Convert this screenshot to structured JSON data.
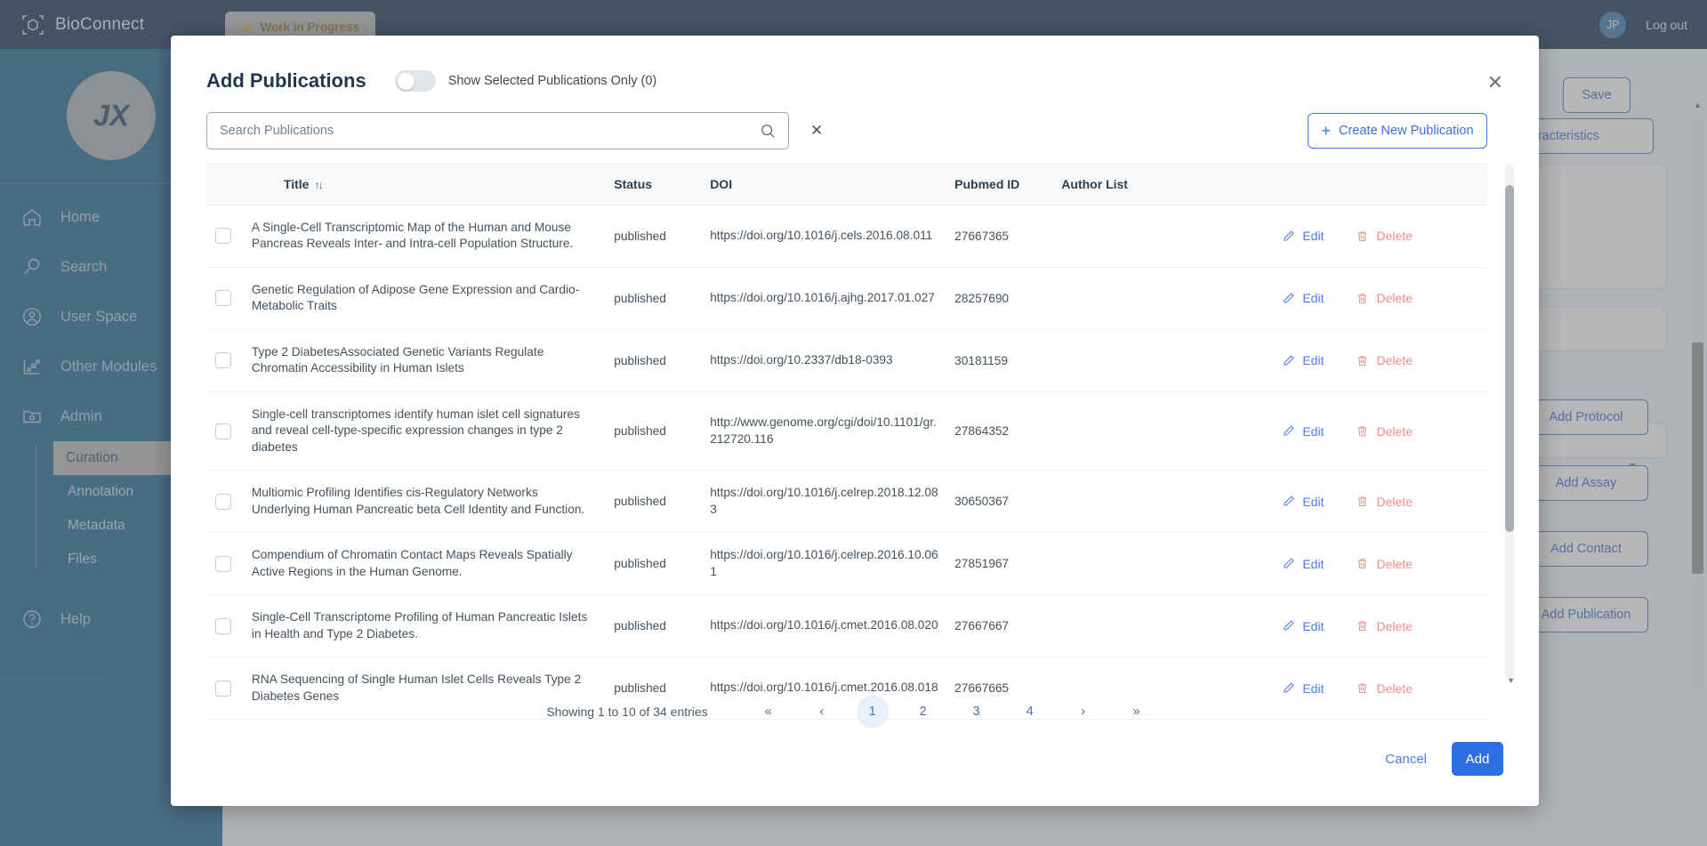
{
  "app": {
    "brand": "BioConnect",
    "brand_icon": "cube-scan-icon",
    "wip_badge": "Work in Progress",
    "wip_icon": "warning-triangle-icon",
    "avatar_initials": "JP",
    "logout": "Log out",
    "org_logo_text": "JX",
    "topbar_color": "#0a2342",
    "sidebar_color": "#0f5c87"
  },
  "sidebar": {
    "items": [
      {
        "label": "Home",
        "icon": "home-icon"
      },
      {
        "label": "Search",
        "icon": "magnifier-icon"
      },
      {
        "label": "User Space",
        "icon": "user-circle-icon"
      },
      {
        "label": "Other Modules",
        "icon": "modules-grid-icon"
      },
      {
        "label": "Admin",
        "icon": "folder-gear-icon"
      }
    ],
    "sub_items": [
      {
        "label": "Curation",
        "active": true
      },
      {
        "label": "Annotation",
        "active": false
      },
      {
        "label": "Metadata",
        "active": false
      },
      {
        "label": "Files",
        "active": false
      }
    ],
    "help": {
      "label": "Help",
      "icon": "help-circle-icon"
    }
  },
  "background_panel": {
    "save_label": "Save",
    "characteristics_label": "d Characteristics",
    "buttons": [
      "Add Protocol",
      "Add Assay",
      "Add Contact",
      "Add Publication"
    ],
    "filter_icon": "funnel-icon"
  },
  "modal": {
    "title": "Add Publications",
    "toggle_label": "Show Selected Publications Only (0)",
    "toggle_on": false,
    "close_icon": "close-icon",
    "search": {
      "placeholder": "Search Publications",
      "value": "",
      "search_icon": "search-icon",
      "clear_icon": "clear-x-icon"
    },
    "create_button": {
      "label": "Create New Publication",
      "icon": "plus-icon"
    },
    "columns": [
      "Title",
      "Status",
      "DOI",
      "Pubmed ID",
      "Author List"
    ],
    "sort_icon": "sort-arrows-icon",
    "row_actions": {
      "edit": {
        "label": "Edit",
        "icon": "pencil-icon",
        "color": "#4c7ce8"
      },
      "delete": {
        "label": "Delete",
        "icon": "trash-icon",
        "color": "#f08b84"
      }
    },
    "rows": [
      {
        "checked": false,
        "title": "A Single-Cell Transcriptomic Map of the Human and Mouse Pancreas Reveals Inter- and Intra-cell Population Structure.",
        "status": "published",
        "doi": "https://doi.org/10.1016/j.cels.2016.08.011",
        "pubmed_id": "27667365",
        "author_list": ""
      },
      {
        "checked": false,
        "title": "Genetic Regulation of Adipose Gene Expression and Cardio-Metabolic Traits",
        "status": "published",
        "doi": "https://doi.org/10.1016/j.ajhg.2017.01.027",
        "pubmed_id": "28257690",
        "author_list": ""
      },
      {
        "checked": false,
        "title": "Type 2 DiabetesAssociated Genetic Variants Regulate Chromatin Accessibility in Human Islets",
        "status": "published",
        "doi": "https://doi.org/10.2337/db18-0393",
        "pubmed_id": "30181159",
        "author_list": ""
      },
      {
        "checked": false,
        "title": "Single-cell transcriptomes identify human islet cell signatures and reveal cell-type-specific expression changes in type 2 diabetes",
        "status": "published",
        "doi": "http://www.genome.org/cgi/doi/10.1101/gr.212720.116",
        "pubmed_id": "27864352",
        "author_list": ""
      },
      {
        "checked": false,
        "title": "Multiomic Profiling Identifies cis-Regulatory Networks Underlying Human Pancreatic beta Cell Identity and Function.",
        "status": "published",
        "doi": "https://doi.org/10.1016/j.celrep.2018.12.083",
        "pubmed_id": "30650367",
        "author_list": ""
      },
      {
        "checked": false,
        "title": "Compendium of Chromatin Contact Maps Reveals Spatially Active Regions in the Human Genome.",
        "status": "published",
        "doi": "https://doi.org/10.1016/j.celrep.2016.10.061",
        "pubmed_id": "27851967",
        "author_list": ""
      },
      {
        "checked": false,
        "title": "Single-Cell Transcriptome Profiling of Human Pancreatic Islets in Health and Type 2 Diabetes.",
        "status": "published",
        "doi": "https://doi.org/10.1016/j.cmet.2016.08.020",
        "pubmed_id": "27667667",
        "author_list": ""
      },
      {
        "checked": false,
        "title": "RNA Sequencing of Single Human Islet Cells Reveals Type 2 Diabetes Genes",
        "status": "published",
        "doi": "https://doi.org/10.1016/j.cmet.2016.08.018",
        "pubmed_id": "27667665",
        "author_list": ""
      }
    ],
    "pagination": {
      "showing": "Showing 1 to 10 of 34 entries",
      "first": "«",
      "prev": "‹",
      "pages": [
        "1",
        "2",
        "3",
        "4"
      ],
      "active_page": "1",
      "next": "›",
      "last": "»"
    },
    "footer": {
      "cancel": "Cancel",
      "add": "Add"
    }
  }
}
